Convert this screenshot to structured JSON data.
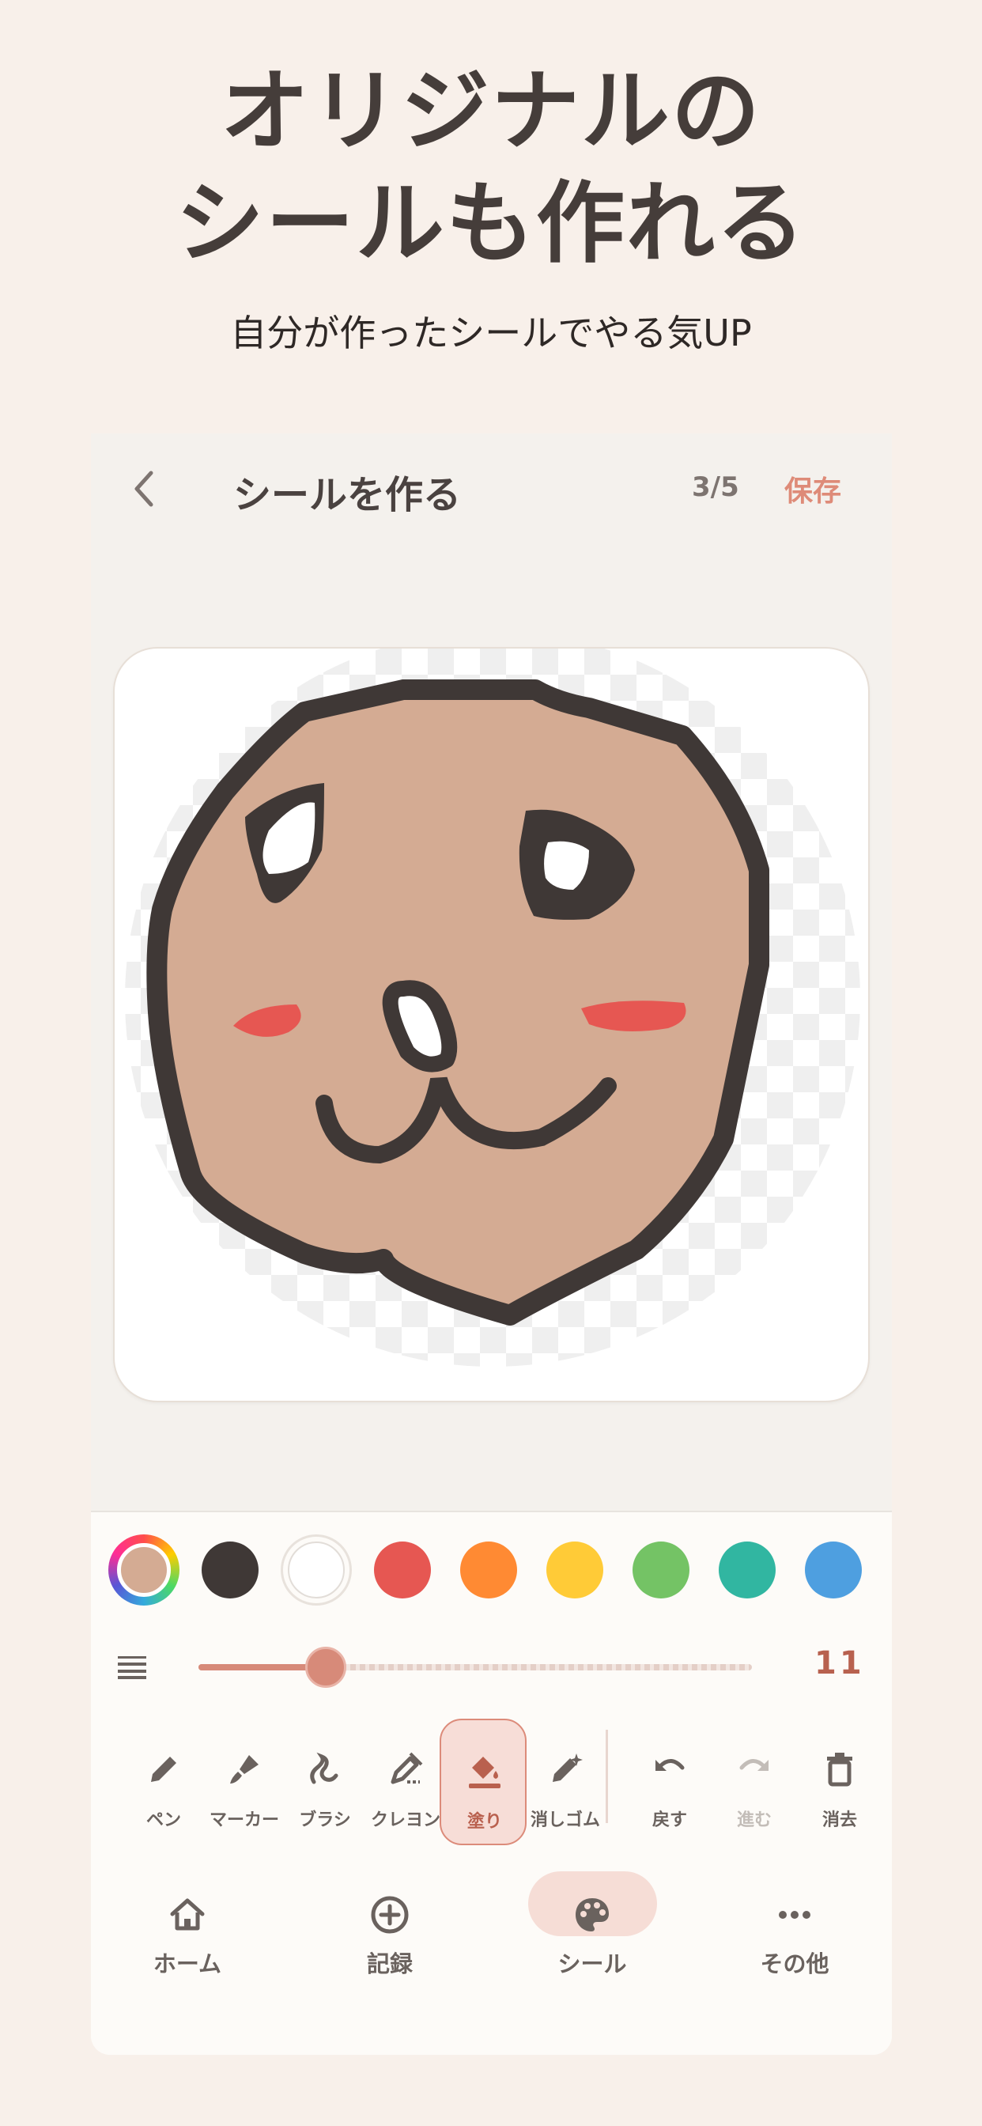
{
  "promo": {
    "headline_line1": "オリジナルの",
    "headline_line2": "シールも作れる",
    "subline": "自分が作ったシールでやる気UP"
  },
  "nav": {
    "title": "シールを作る",
    "page_indicator": "3/5",
    "save_label": "保存"
  },
  "palette": {
    "current_color": "#d4ab93",
    "colors": [
      "#3f3836",
      "#ffffff",
      "#e65752",
      "#ff8a33",
      "#ffcb37",
      "#74c365",
      "#31b6a1",
      "#4e9fe0"
    ]
  },
  "brush_size": {
    "value": "11",
    "slider_fraction": 0.23
  },
  "tools": [
    {
      "label": "ペン",
      "icon": "pen-icon",
      "active": false
    },
    {
      "label": "マーカー",
      "icon": "marker-icon",
      "active": false
    },
    {
      "label": "ブラシ",
      "icon": "brush-icon",
      "active": false
    },
    {
      "label": "クレヨン",
      "icon": "crayon-icon",
      "active": false
    },
    {
      "label": "塗り",
      "icon": "fill-bucket-icon",
      "active": true
    },
    {
      "label": "消しゴム",
      "icon": "eraser-icon",
      "active": false
    }
  ],
  "actions": [
    {
      "label": "戻す",
      "icon": "undo-icon",
      "enabled": true
    },
    {
      "label": "進む",
      "icon": "redo-icon",
      "enabled": false
    },
    {
      "label": "消去",
      "icon": "trash-icon",
      "enabled": true
    }
  ],
  "tabbar": [
    {
      "label": "ホーム",
      "icon": "home-icon",
      "selected": false
    },
    {
      "label": "記録",
      "icon": "add-circle-icon",
      "selected": false
    },
    {
      "label": "シール",
      "icon": "palette-icon",
      "selected": true
    },
    {
      "label": "その他",
      "icon": "more-icon",
      "selected": false
    }
  ],
  "colors": {
    "accent": "#de8b78",
    "background": "#f8f0ea",
    "text": "#4a4240",
    "face_fill": "#d4ab93",
    "cheeks": "#e65752"
  }
}
